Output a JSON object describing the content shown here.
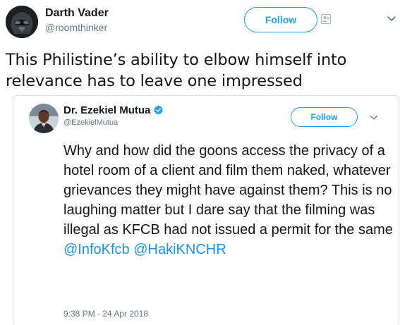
{
  "outer_tweet": {
    "author_name": "Darth Vader",
    "author_handle": "@roomthinker",
    "follow_label": "Follow",
    "text": "This Philistine’s ability to elbow himself into relevance has to leave one impressed"
  },
  "quoted_tweet": {
    "author_name": "Dr. Ezekiel Mutua",
    "author_handle": "@EzekielMutua",
    "verified": true,
    "follow_label": "Follow",
    "text": "Why and how did the goons access the privacy of a hotel room of a client and film them naked, whatever grievances they might have against them? This is no laughing matter but I dare say that the filming was illegal as KFCB had not issued a permit for the same",
    "mentions": "@InfoKfcb @HakiKNCHR",
    "timestamp": "9:38 PM - 24 Apr 2018"
  },
  "colors": {
    "accent": "#1da1f2",
    "link": "#1b95e0",
    "text_primary": "#14171a",
    "text_secondary": "#657786",
    "border": "#d8dde2"
  },
  "icons": [
    "add-user-icon",
    "chevron-down-icon",
    "verified-badge-icon"
  ]
}
